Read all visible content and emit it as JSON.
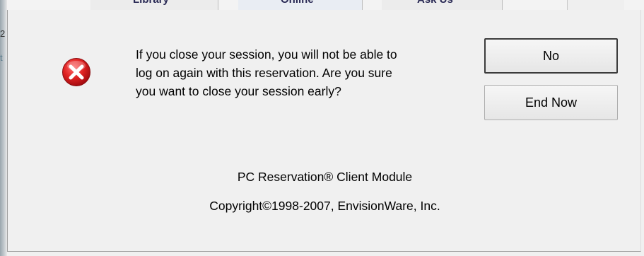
{
  "background": {
    "tiles": [
      "Library",
      "Online",
      "Ask Us"
    ],
    "left_glyphs": [
      "2",
      "t"
    ]
  },
  "dialog": {
    "message": "If you close your session, you will not be able to\nlog on again with this reservation.  Are you sure\nyou want to close your session early?",
    "buttons": {
      "no": "No",
      "end_now": "End Now"
    },
    "product": "PC Reservation® Client Module",
    "copyright": "Copyright©1998-2007, EnvisionWare, Inc."
  },
  "icons": {
    "error": "error-icon"
  },
  "colors": {
    "dialog_background": "#f0f0f0",
    "error_red": "#d3141e"
  }
}
